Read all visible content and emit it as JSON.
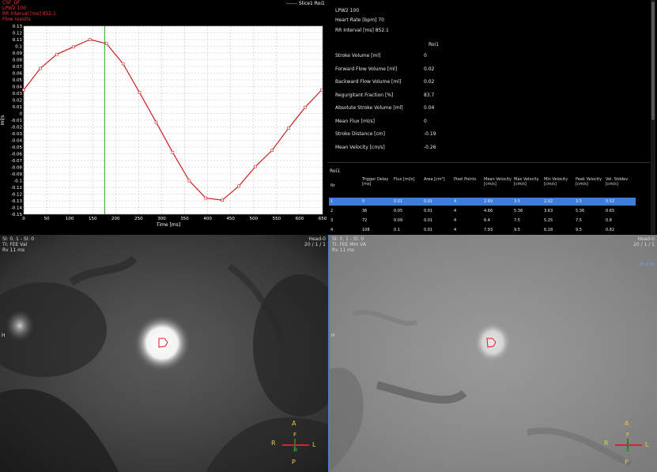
{
  "chart": {
    "header_lines": [
      "CSF_QF",
      "LPW2 100",
      "RR Interval [ms] 852.1",
      "Flow results"
    ],
    "legend_label": "Slice1 Roi1",
    "y_unit": "ml/s",
    "x_label": "Time [ms]",
    "y_ticks": [
      "0.13",
      "0.12",
      "0.11",
      "0.1",
      "0.09",
      "0.08",
      "0.07",
      "0.06",
      "0.05",
      "0.04",
      "0.03",
      "0.02",
      "0.01",
      "0",
      "-0.01",
      "-0.02",
      "-0.03",
      "-0.04",
      "-0.05",
      "-0.06",
      "-0.07",
      "-0.08",
      "-0.09",
      "-0.1",
      "-0.11",
      "-0.12",
      "-0.13",
      "-0.14",
      "-0.15"
    ],
    "x_ticks": [
      "0",
      "50",
      "100",
      "150",
      "200",
      "250",
      "300",
      "350",
      "400",
      "450",
      "500",
      "550",
      "600",
      "650"
    ],
    "marker_time": 176
  },
  "chart_data": {
    "type": "line",
    "title": "",
    "xlabel": "Time [ms]",
    "ylabel": "ml/s",
    "xlim": [
      0,
      650
    ],
    "ylim": [
      -0.15,
      0.13
    ],
    "series": [
      {
        "name": "Slice1 Roi1",
        "x": [
          0,
          36,
          72,
          108,
          144,
          180,
          216,
          252,
          288,
          324,
          360,
          396,
          432,
          468,
          504,
          540,
          576,
          612,
          648
        ],
        "y": [
          0.035,
          0.067,
          0.088,
          0.099,
          0.11,
          0.104,
          0.074,
          0.031,
          -0.013,
          -0.058,
          -0.1,
          -0.126,
          -0.129,
          -0.108,
          -0.079,
          -0.055,
          -0.022,
          0.009,
          0.035
        ]
      }
    ]
  },
  "info": {
    "sequence": "LPW2 100",
    "heart_rate": "Heart Rate [bpm] 70",
    "rr_interval": "RR Interval [ms] 852.1",
    "roi_header": "Roi1",
    "rows": [
      {
        "label": "Stroke Volume [ml]",
        "value": "0"
      },
      {
        "label": "Forward Flow Volume [ml]",
        "value": "0.02"
      },
      {
        "label": "Backward Flow Volume [ml]",
        "value": "0.02"
      },
      {
        "label": "Regurgitant Fraction [%]",
        "value": "83.7"
      },
      {
        "label": "Absolute Stroke Volume [ml]",
        "value": "0.04"
      },
      {
        "label": "Mean Flux [ml/s]",
        "value": "0"
      },
      {
        "label": "Stroke Distance [cm]",
        "value": "-0.19"
      },
      {
        "label": "Mean Velocity [cm/s]",
        "value": "-0.26"
      }
    ],
    "table_title": "Roi1",
    "columns": [
      "Nr",
      "Trigger Delay [ms]",
      "Flux [ml/s]",
      "Area [cm²]",
      "Pixel Points",
      "Mean Velocity [cm/s]",
      "Max Velocity [cm/s]",
      "Min Velocity [cm/s]",
      "Peak Velocity [cm/s]",
      "Vel. Stddev [cm/s]"
    ],
    "table_rows": [
      [
        "1",
        "0",
        "0.01",
        "0.01",
        "4",
        "2.69",
        "3.5",
        "2.02",
        "3.5",
        "0.52"
      ],
      [
        "2",
        "36",
        "0.05",
        "0.01",
        "4",
        "4.66",
        "5.36",
        "3.63",
        "5.36",
        "0.65"
      ],
      [
        "3",
        "72",
        "0.09",
        "0.01",
        "4",
        "6.4",
        "7.5",
        "5.25",
        "7.5",
        "0.8"
      ],
      [
        "4",
        "108",
        "0.1",
        "0.01",
        "4",
        "7.93",
        "9.5",
        "6.18",
        "9.5",
        "0.82"
      ]
    ]
  },
  "viewer_left": {
    "top_left": [
      "Sl: 0, 1 - Sl: 0",
      "TI: FEE   Val",
      "Rv 11 ms"
    ],
    "top_right": [
      "Head-0",
      "20 / 1 / 1"
    ],
    "side_label": "H"
  },
  "viewer_right": {
    "top_left": [
      "Sl: 0, 1 - Sl: 0",
      "TI: FEE   Mm VA",
      "Rv 11 ms"
    ],
    "top_right": [
      "Head-0",
      "20 / 1 / 1"
    ],
    "side_label": "H",
    "corner_tag": "Ph 1 80"
  },
  "orientation": {
    "a": "A",
    "p": "P",
    "r": "R",
    "l": "L",
    "f": "F",
    "h": "H"
  },
  "colors": {
    "line": "#cc2020",
    "marker": "#22aa22",
    "selected": "#3d7fd6",
    "orient": "#e6c84a"
  }
}
